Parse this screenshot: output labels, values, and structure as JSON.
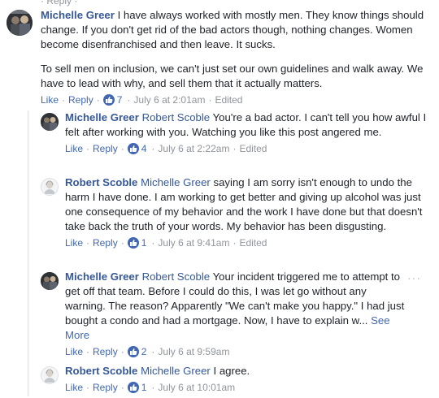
{
  "top_partial": "· Reply · ",
  "comments": [
    {
      "author": "Michelle Greer",
      "mention": "",
      "text": "I have always worked with mostly men. They know things should change. If you don't get rid of the bad actors though, nothing changes. Women become disenfranchised and then leave. It sucks.",
      "text2": "To sell men on inclusion, we can't just set our own guidelines and walk away. We have to lead with why, and sell them that it actually matters.",
      "like_label": "Like",
      "reply_label": "Reply",
      "likes": "7",
      "time": "July 6 at 2:01am",
      "edited": "Edited"
    },
    {
      "author": "Michelle Greer",
      "mention": "Robert Scoble",
      "text": "You're a bad actor. I can't tell you how awful I felt after working with you. Watching you like this post angered me.",
      "like_label": "Like",
      "reply_label": "Reply",
      "likes": "4",
      "time": "July 6 at 2:22am",
      "edited": "Edited"
    },
    {
      "author": "Robert Scoble",
      "mention": "Michelle Greer",
      "text": "saying I am sorry isn't enough to undo the harm I have done. I am working to get better and giving up alcohol was just one consequence of my behavior and the work I have done but that doesn't take back the truth of your words. My behavior has been disgusting.",
      "like_label": "Like",
      "reply_label": "Reply",
      "likes": "1",
      "time": "July 6 at 9:41am",
      "edited": "Edited"
    },
    {
      "author": "Michelle Greer",
      "mention": "Robert Scoble",
      "text": "Your incident triggered me to attempt to get off that team. Before I could do this, I was let go without any warning. The reason? Apparently \"We can't make you happy.\" I had just bought a condo and had a mortgage. Now, I have to explain w...",
      "see_more": "See More",
      "like_label": "Like",
      "reply_label": "Reply",
      "likes": "2",
      "time": "July 6 at 9:59am"
    },
    {
      "author": "Robert Scoble",
      "mention": "Michelle Greer",
      "text": "I agree.",
      "like_label": "Like",
      "reply_label": "Reply",
      "likes": "1",
      "time": "July 6 at 10:01am"
    }
  ],
  "more_options": "···",
  "colors": {
    "link": "#365899",
    "action": "#4267b2",
    "meta": "#90949c",
    "text": "#1d2129"
  }
}
